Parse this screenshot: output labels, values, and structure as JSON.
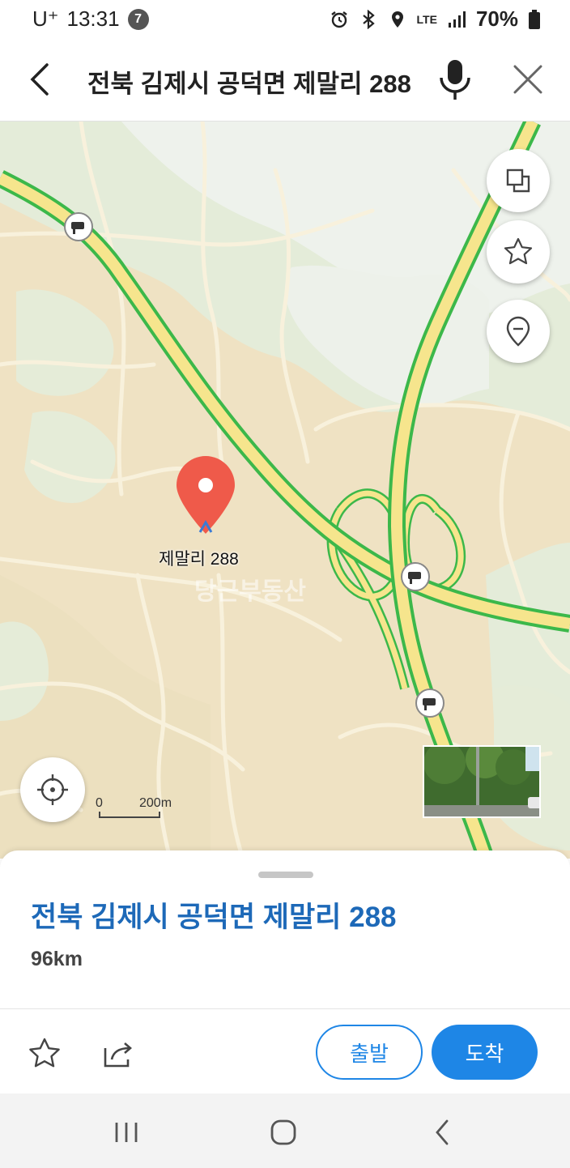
{
  "status_bar": {
    "carrier": "U⁺",
    "time": "13:31",
    "notification_count": "7",
    "network": "LTE",
    "battery": "70%"
  },
  "search": {
    "query": "전북 김제시 공덕면 제말리 288"
  },
  "map": {
    "pin_label": "제말리 288",
    "watermark": "당근부동산",
    "scale_start": "0",
    "scale_end": "200m"
  },
  "sheet": {
    "title": "전북 김제시 공덕면 제말리 288",
    "distance": "96km",
    "depart_label": "출발",
    "arrive_label": "도착"
  },
  "colors": {
    "accent": "#1e86e6",
    "title_blue": "#1d69b8",
    "pin_red": "#ef5a4a",
    "road_yellow": "#f6e58d",
    "road_green": "#3cb84a"
  }
}
